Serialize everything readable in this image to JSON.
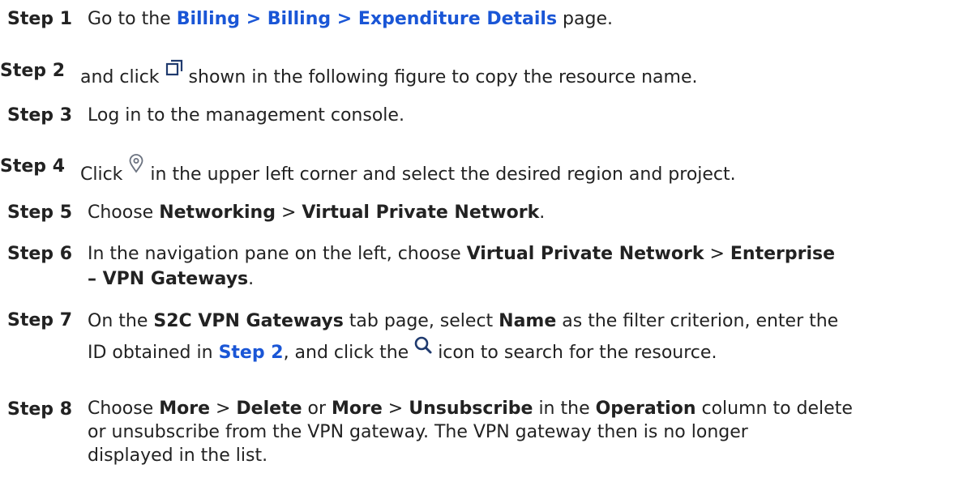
{
  "steps": [
    {
      "label": "Step 1",
      "pre": "Go to the ",
      "link": "Billing > Billing > Expenditure Details",
      "post": " page."
    },
    {
      "label": "Step 2",
      "pre": "and click",
      "icon": "copy-icon",
      "post": "shown in the following figure to copy the resource name."
    },
    {
      "label": "Step 3",
      "text": "Log in to the management console."
    },
    {
      "label": "Step 4",
      "pre": "Click",
      "icon": "location-pin-icon",
      "post": "in the upper left corner and select the desired region and project."
    },
    {
      "label": "Step 5",
      "pre": "Choose ",
      "b1": "Networking",
      "mid": " > ",
      "b2": "Virtual Private Network",
      "post": "."
    },
    {
      "label": "Step 6",
      "pre": "In the navigation pane on the left, choose ",
      "b1": "Virtual Private Network",
      "mid": " > ",
      "b2": "Enterprise",
      "line2_bold": "– VPN Gateways",
      "line2_post": "."
    },
    {
      "label": "Step 7",
      "pre": "On the ",
      "b1": "S2C VPN Gateways",
      "mid1": " tab page, select ",
      "b2": "Name",
      "mid2": " as the filter criterion, enter the",
      "line2_pre": "ID obtained in ",
      "line2_link": "Step 2",
      "line2_mid": ", and click the",
      "icon": "search-icon",
      "line2_post": "icon to search for the resource."
    },
    {
      "label": "Step 8",
      "pre": "Choose ",
      "b1": "More",
      "mid1": " > ",
      "b2": "Delete",
      "mid2": " or ",
      "b3": "More",
      "mid3": " > ",
      "b4": "Unsubscribe",
      "mid4": " in the ",
      "b5": "Operation",
      "mid5": " column to delete",
      "line2": "or unsubscribe from the VPN gateway. The VPN gateway then is no longer",
      "line3": "displayed in the list."
    }
  ],
  "colors": {
    "link": "#1a56d6",
    "text": "#222222",
    "icon": "#1f3a6e"
  }
}
